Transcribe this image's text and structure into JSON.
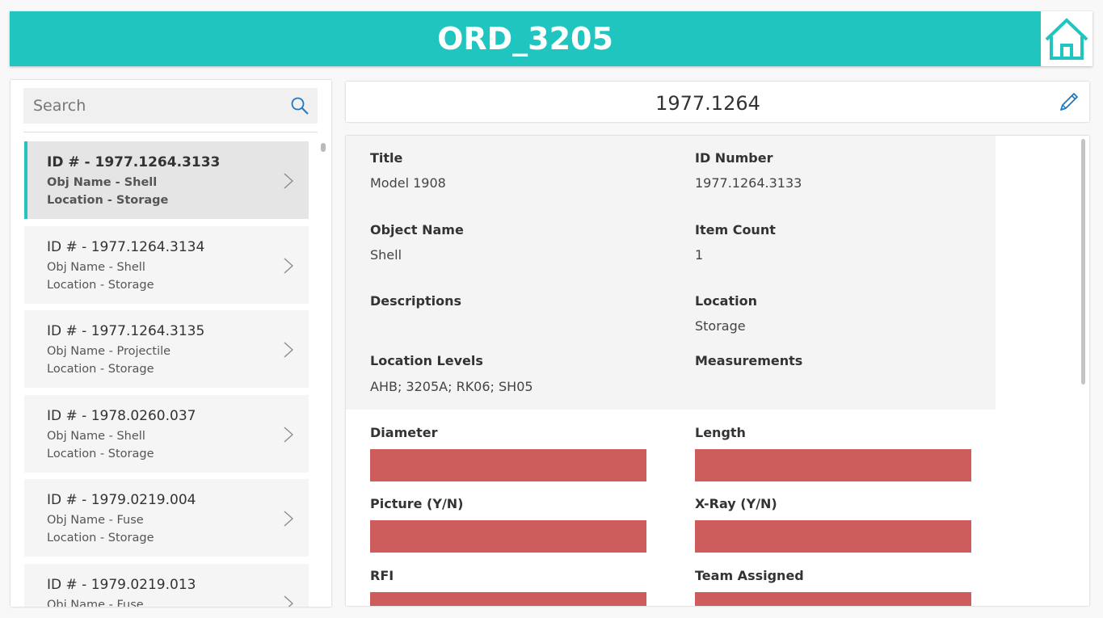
{
  "header": {
    "title": "ORD_3205",
    "home_icon": "home-icon"
  },
  "search": {
    "placeholder": "Search",
    "value": ""
  },
  "list": {
    "items": [
      {
        "id": "ID # - 1977.1264.3133",
        "obj": "Obj Name - Shell",
        "loc": "Location - Storage"
      },
      {
        "id": "ID # - 1977.1264.3134",
        "obj": "Obj Name - Shell",
        "loc": "Location - Storage"
      },
      {
        "id": "ID # - 1977.1264.3135",
        "obj": "Obj Name - Projectile",
        "loc": "Location - Storage"
      },
      {
        "id": "ID # - 1978.0260.037",
        "obj": "Obj Name - Shell",
        "loc": "Location - Storage"
      },
      {
        "id": "ID # - 1979.0219.004",
        "obj": "Obj Name - Fuse",
        "loc": "Location - Storage"
      },
      {
        "id": "ID # - 1979.0219.013",
        "obj": "Obj Name - Fuse",
        "loc": ""
      }
    ]
  },
  "detail": {
    "title": "1977.1264",
    "fields": {
      "title_label": "Title",
      "title_value": "Model 1908",
      "id_label": "ID Number",
      "id_value": "1977.1264.3133",
      "objname_label": "Object Name",
      "objname_value": "Shell",
      "count_label": "Item Count",
      "count_value": "1",
      "desc_label": "Descriptions",
      "desc_value": "",
      "location_label": "Location",
      "location_value": "Storage",
      "levels_label": "Location Levels",
      "levels_value": "AHB; 3205A; RK06; SH05",
      "measure_label": "Measurements",
      "measure_value": "",
      "diameter_label": "Diameter",
      "length_label": "Length",
      "picture_label": "Picture (Y/N)",
      "xray_label": "X-Ray (Y/N)",
      "rfi_label": "RFI",
      "team_label": "Team Assigned"
    }
  },
  "colors": {
    "accent": "#20c5bf",
    "required_field": "#cd5c5c",
    "icon_blue": "#1e78c8"
  }
}
